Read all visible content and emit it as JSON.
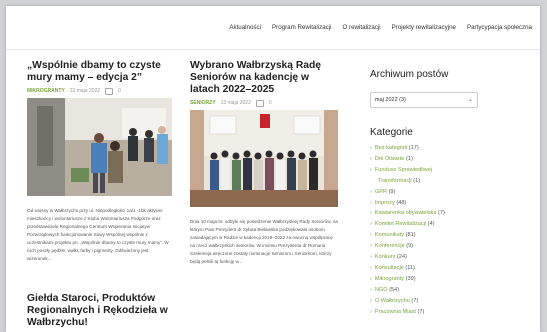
{
  "nav": {
    "items": [
      "Aktualności",
      "Program Rewitalizacji",
      "O rewitalizacji",
      "Projekty rewitalizacyjne",
      "Partycypacja społeczna"
    ]
  },
  "posts": [
    {
      "title": "„Wspólnie dbamy to czyste mury mamy – edycja 2”",
      "category": "MIKROGRANTY",
      "date": "23 maja 2022",
      "comments": "0",
      "excerpt": "Od wiosny w Wałbrzychu przy ul. Niepodległości 1a/1 -1bk aktywni mieszkańcy i wolontariusze z Klubu Wolontariusza Podgórze oraz przedstawiciele Regionalnego Centrum Wspierania Inicjatyw Pozarządowych funkcjonowanie Sowy Wspólnej wspólnie z uczestnikami projektu pn. „Wspólnie dbamy to czyste mury mamy”. W ruch poszły pędzle, wałki, farby i pigmenty. Odświeżony jest wizerunek..."
    },
    {
      "title": "Wybrano Wałbrzyską Radę Seniorów na kadencję w latach 2022–2025",
      "category": "SENIORZY",
      "date": "13 maja 2022",
      "comments": "0",
      "excerpt": "Dnia 10 maja br. odbyło się posiedzenie Wałbrzyskiej Rady Seniorów, na którym Pani Prezydent dr Sylwia Bielawska podziękowała osobom zasiadającym w Radzie w kadencji 2019–2022 za owocną współpracę na rzecz wałbrzyskich seniorów. W imieniu Prezydenta dr Romana Szełemeja wręczone zostały nominacje Seniorom i Seniorkom, którzy będą pełnili tą funkcję w..."
    },
    {
      "title": "Giełda Staroci, Produktów Regionalnych i Rękodzieła w Wałbrzychu!"
    }
  ],
  "sidebar": {
    "archive_title": "Archiwum postów",
    "archive_selected": "maj 2022  (3)",
    "categories_title": "Kategorie",
    "categories": [
      {
        "name": "Bez kategorii",
        "count": "(17)"
      },
      {
        "name": "Dni Otwarte",
        "count": "(1)"
      },
      {
        "name": "Fundusz Sprawiedliwej",
        "count": ""
      },
      {
        "name": "Transformacji",
        "count": "(1)"
      },
      {
        "name": "GPR",
        "count": "(9)"
      },
      {
        "name": "Imprezy",
        "count": "(48)"
      },
      {
        "name": "Kawiarenka obywatelska",
        "count": "(7)"
      },
      {
        "name": "Komitet Rewitalizacji",
        "count": "(4)"
      },
      {
        "name": "Komunikaty",
        "count": "(81)"
      },
      {
        "name": "Konferencje",
        "count": "(9)"
      },
      {
        "name": "Konkurs",
        "count": "(24)"
      },
      {
        "name": "Konsultacje",
        "count": "(11)"
      },
      {
        "name": "Mikrogranty",
        "count": "(39)"
      },
      {
        "name": "NGO",
        "count": "(54)"
      },
      {
        "name": "O Wałbrzychu",
        "count": "(7)"
      },
      {
        "name": "Pracownia Miast",
        "count": "(7)"
      }
    ]
  },
  "colors": {
    "accent": "#7aa33c",
    "background": "#cfd3d6"
  }
}
